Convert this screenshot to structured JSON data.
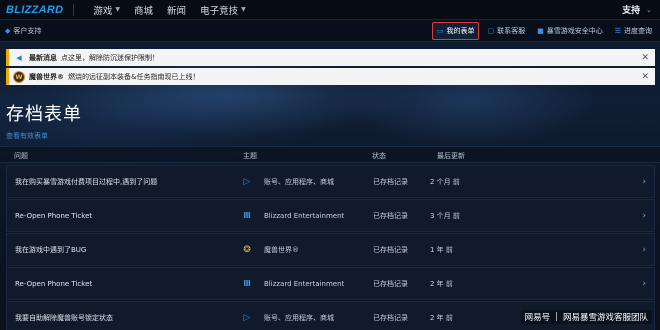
{
  "topnav": {
    "logo": "BLIZZARD",
    "items": [
      {
        "label": "游戏",
        "has_dropdown": true
      },
      {
        "label": "商城",
        "has_dropdown": false
      },
      {
        "label": "新闻",
        "has_dropdown": false
      },
      {
        "label": "电子竞技",
        "has_dropdown": true
      }
    ],
    "right_label": "支持"
  },
  "subbar": {
    "support_label": "客户支持",
    "buttons": [
      {
        "label": "我的表单",
        "icon": "ticket-icon",
        "active": true
      },
      {
        "label": "联系客服",
        "icon": "chat-icon",
        "active": false
      },
      {
        "label": "暴雪游戏安全中心",
        "icon": "lock-icon",
        "active": false
      },
      {
        "label": "进度查询",
        "icon": "list-icon",
        "active": false
      }
    ]
  },
  "alerts": [
    {
      "title": "最新消息",
      "text": "点这里，解除防沉迷保护限制！",
      "icon": "megaphone-icon"
    },
    {
      "title": "魔兽世界®",
      "text": "燃烧的远征副本装备&任务指南现已上线！",
      "icon": "wow-icon"
    }
  ],
  "page": {
    "title": "存档表单",
    "view_link": "查看有效表单"
  },
  "table": {
    "headers": {
      "issue": "问题",
      "topic": "主题",
      "status": "状态",
      "updated": "最后更新"
    },
    "rows": [
      {
        "issue": "我在购买暴雪游戏付费项目过程中,遇到了问题",
        "topic_icon": "battlenet-icon",
        "topic": "账号、应用程序、商城",
        "status": "已存档记录",
        "updated": "2 个月 前"
      },
      {
        "issue": "Re-Open Phone Ticket",
        "topic_icon": "blizzard-icon",
        "topic": "Blizzard Entertainment",
        "status": "已存档记录",
        "updated": "3 个月 前"
      },
      {
        "issue": "我在游戏中遇到了BUG",
        "topic_icon": "wow-icon",
        "topic": "魔兽世界®",
        "status": "已存档记录",
        "updated": "1 年 前"
      },
      {
        "issue": "Re-Open Phone Ticket",
        "topic_icon": "blizzard-icon",
        "topic": "Blizzard Entertainment",
        "status": "已存档记录",
        "updated": "2 年 前"
      },
      {
        "issue": "我要自助解除魔兽账号锁定状态",
        "topic_icon": "battlenet-icon",
        "topic": "账号、应用程序、商城",
        "status": "已存档记录",
        "updated": "2 年 前"
      }
    ]
  },
  "watermark": {
    "brand": "网易号",
    "sep": "|",
    "author": "网易暴雪游戏客服团队"
  }
}
